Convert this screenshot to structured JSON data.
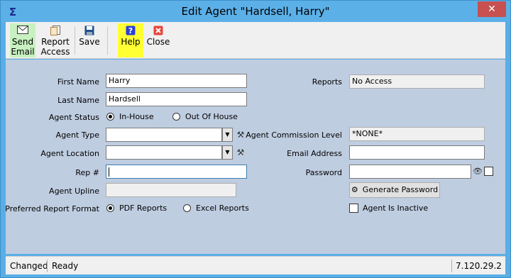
{
  "window": {
    "title": "Edit Agent \"Hardsell, Harry\"",
    "close_glyph": "✕"
  },
  "toolbar": {
    "send_email_line1": "Send",
    "send_email_line2": "Email",
    "report_access_line1": "Report",
    "report_access_line2": "Access",
    "save_label": "Save",
    "help_label": "Help",
    "close_label": "Close",
    "icons": [
      "envelope-icon",
      "report-icon",
      "floppy-icon",
      "help-icon",
      "close-icon"
    ]
  },
  "form": {
    "first_name_label": "First Name",
    "first_name_value": "Harry",
    "last_name_label": "Last Name",
    "last_name_value": "Hardsell",
    "agent_status_label": "Agent Status",
    "status_in_house": "In-House",
    "status_out_of_house": "Out Of House",
    "agent_type_label": "Agent Type",
    "agent_type_value": "",
    "agent_location_label": "Agent Location",
    "agent_location_value": "",
    "rep_label": "Rep #",
    "rep_value": "",
    "agent_upline_label": "Agent Upline",
    "agent_upline_value": "",
    "preferred_report_format_label": "Preferred Report Format",
    "format_pdf": "PDF Reports",
    "format_excel": "Excel Reports",
    "reports_label": "Reports",
    "reports_value": "No Access",
    "agent_commission_level_label": "Agent Commission Level",
    "agent_commission_level_value": "*NONE*",
    "email_address_label": "Email Address",
    "email_address_value": "",
    "password_label": "Password",
    "password_value": "",
    "generate_password_label": "Generate Password",
    "agent_is_inactive_label": "Agent Is Inactive"
  },
  "status": {
    "state": "Changed",
    "message": "Ready",
    "version": "7.120.29.2"
  },
  "colors": {
    "title_bar": "#5cb0e8",
    "form_background": "#bfcde1",
    "send_email_highlight": "#c8f0c0",
    "help_highlight": "#ffff33",
    "close_icon": "#e8453c"
  }
}
